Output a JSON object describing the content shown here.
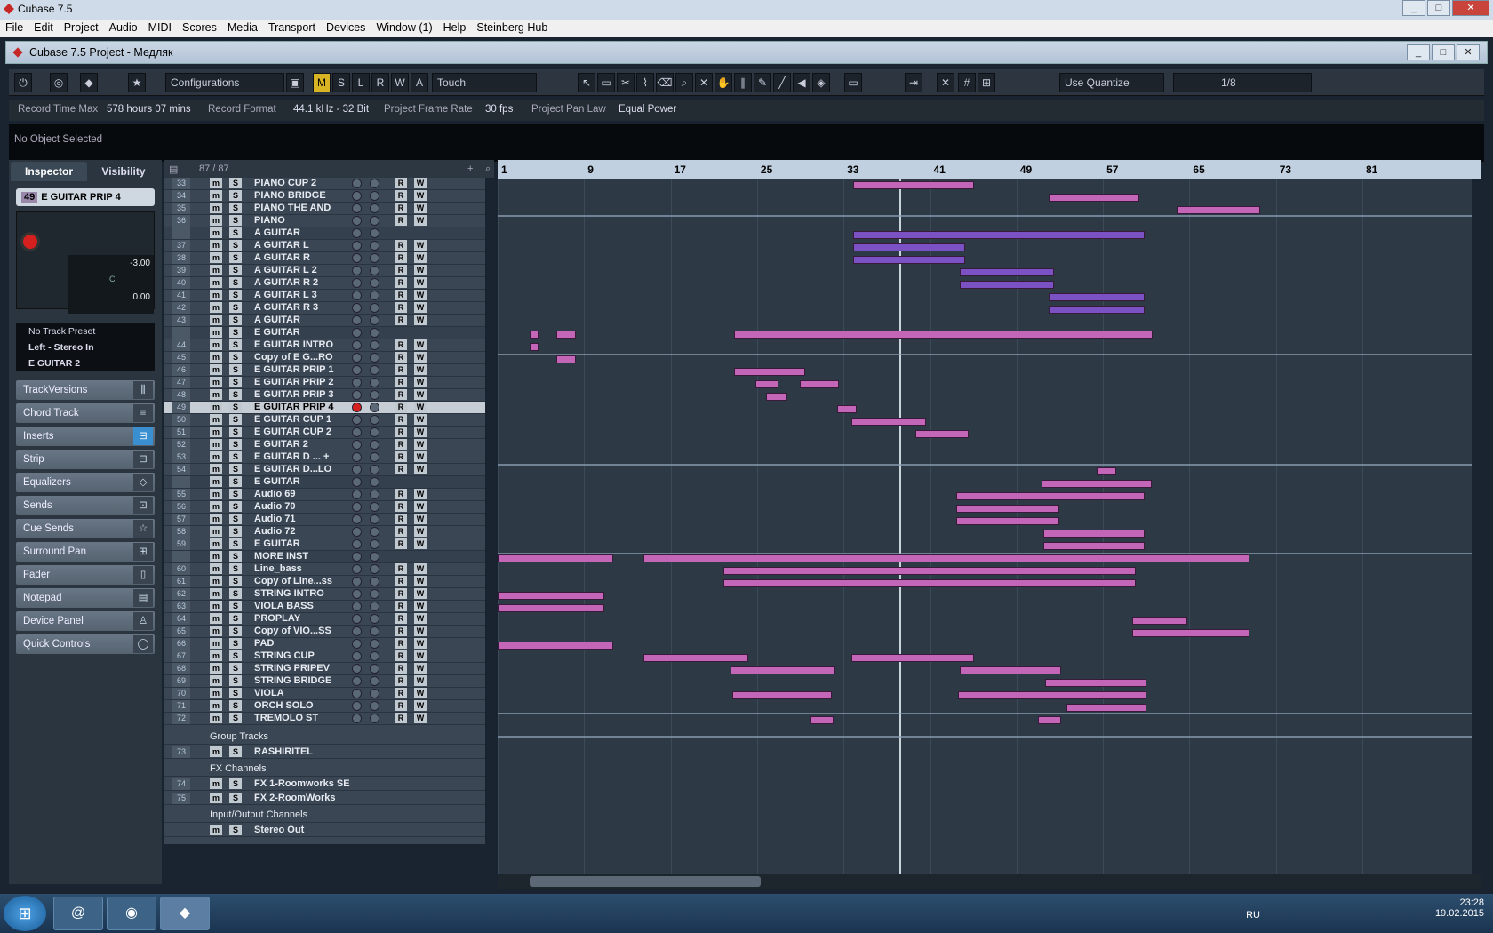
{
  "window_title": "Cubase 7.5",
  "menu": [
    "File",
    "Edit",
    "Project",
    "Audio",
    "MIDI",
    "Scores",
    "Media",
    "Transport",
    "Devices",
    "Window (1)",
    "Help",
    "Steinberg Hub"
  ],
  "project_title": "Cubase 7.5 Project - Медляк",
  "toolbar": {
    "m": "M",
    "s": "S",
    "l": "L",
    "r": "R",
    "w": "W",
    "a": "A",
    "configurations": "Configurations",
    "automation": "Touch",
    "quantize": "Use Quantize",
    "quant_value": "1/8"
  },
  "info": {
    "record_time_max_label": "Record Time Max",
    "record_time_max": "578 hours 07 mins",
    "record_format_label": "Record Format",
    "record_format": "44.1 kHz - 32 Bit",
    "frame_rate_label": "Project Frame Rate",
    "frame_rate": "30 fps",
    "pan_law_label": "Project Pan Law",
    "pan_law": "Equal Power"
  },
  "selection": "No Object Selected",
  "inspector": {
    "tab_inspector": "Inspector",
    "tab_visibility": "Visibility",
    "track_num": "49",
    "track_name": "E GUITAR PRIP 4",
    "volume": "-3.00",
    "pan": "C",
    "delay": "0.00",
    "preset": "No Track Preset",
    "input": "Left - Stereo In",
    "output": "E GUITAR 2",
    "sections": [
      "TrackVersions",
      "Chord Track",
      "Inserts",
      "Strip",
      "Equalizers",
      "Sends",
      "Cue Sends",
      "Surround Pan",
      "Fader",
      "Notepad",
      "Device Panel",
      "Quick Controls"
    ]
  },
  "track_count": "87 / 87",
  "tracks": [
    {
      "n": "33",
      "name": "PIANO CUP 2"
    },
    {
      "n": "34",
      "name": "PIANO BRIDGE"
    },
    {
      "n": "35",
      "name": "PIANO THE AND"
    },
    {
      "n": "36",
      "name": "PIANO"
    },
    {
      "n": "",
      "name": "A GUITAR"
    },
    {
      "n": "37",
      "name": "A GUITAR L"
    },
    {
      "n": "38",
      "name": "A GUITAR R"
    },
    {
      "n": "39",
      "name": "A GUITAR L 2"
    },
    {
      "n": "40",
      "name": "A GUITAR R 2"
    },
    {
      "n": "41",
      "name": "A GUITAR L 3"
    },
    {
      "n": "42",
      "name": "A GUITAR R 3"
    },
    {
      "n": "43",
      "name": "A GUITAR"
    },
    {
      "n": "",
      "name": "E GUITAR"
    },
    {
      "n": "44",
      "name": "E GUITAR INTRO"
    },
    {
      "n": "45",
      "name": "Copy of E G...RO"
    },
    {
      "n": "46",
      "name": "E GUITAR PRIP 1"
    },
    {
      "n": "47",
      "name": "E GUITAR PRIP 2"
    },
    {
      "n": "48",
      "name": "E GUITAR PRIP 3"
    },
    {
      "n": "49",
      "name": "E GUITAR PRIP 4"
    },
    {
      "n": "50",
      "name": "E GUITAR CUP 1"
    },
    {
      "n": "51",
      "name": "E GUITAR CUP 2"
    },
    {
      "n": "52",
      "name": "E GUITAR 2"
    },
    {
      "n": "53",
      "name": "E GUITAR D ... +"
    },
    {
      "n": "54",
      "name": "E GUITAR D...LO"
    },
    {
      "n": "",
      "name": "E GUITAR"
    },
    {
      "n": "55",
      "name": "Audio 69"
    },
    {
      "n": "56",
      "name": "Audio 70"
    },
    {
      "n": "57",
      "name": "Audio 71"
    },
    {
      "n": "58",
      "name": "Audio 72"
    },
    {
      "n": "59",
      "name": "E GUITAR"
    },
    {
      "n": "",
      "name": "MORE INST"
    },
    {
      "n": "60",
      "name": "Line_bass"
    },
    {
      "n": "61",
      "name": "Copy of Line...ss"
    },
    {
      "n": "62",
      "name": "STRING INTRO"
    },
    {
      "n": "63",
      "name": "VIOLA BASS"
    },
    {
      "n": "64",
      "name": "PROPLAY"
    },
    {
      "n": "65",
      "name": "Copy of VIO...SS"
    },
    {
      "n": "66",
      "name": "PAD"
    },
    {
      "n": "67",
      "name": "STRING CUP"
    },
    {
      "n": "68",
      "name": "STRING PRIPEV"
    },
    {
      "n": "69",
      "name": "STRING BRIDGE"
    },
    {
      "n": "70",
      "name": "VIOLA"
    },
    {
      "n": "71",
      "name": "ORCH SOLO"
    },
    {
      "n": "72",
      "name": "TREMOLO ST"
    }
  ],
  "groups": {
    "group_tracks": "Group Tracks",
    "rashiritel_n": "73",
    "rashiritel": "RASHIRITEL",
    "fx_channels": "FX Channels",
    "fx1_n": "74",
    "fx1": "FX 1-Roomworks SE",
    "fx2_n": "75",
    "fx2": "FX 2-RoomWorks",
    "io_channels": "Input/Output Channels",
    "stereo_out": "Stereo Out"
  },
  "ruler": [
    "1",
    "9",
    "17",
    "25",
    "33",
    "41",
    "49",
    "57",
    "65",
    "73",
    "81"
  ],
  "colors": {
    "purple": "#7a52c4",
    "pink": "#c466b8",
    "accent": "#d8b323"
  },
  "taskbar": {
    "lang": "RU",
    "time": "23:28",
    "date": "19.02.2015"
  }
}
